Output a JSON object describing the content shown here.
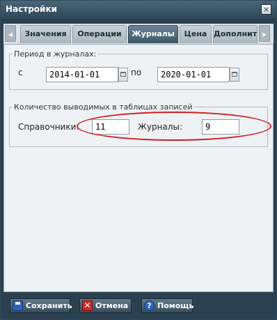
{
  "window": {
    "title": "Настройки",
    "close_glyph": "×"
  },
  "tabs": [
    {
      "label": "Значения"
    },
    {
      "label": "Операции"
    },
    {
      "label": "Журналы"
    },
    {
      "label": "Цена"
    },
    {
      "label": "Дополнит"
    }
  ],
  "tab_scroll": {
    "left_glyph": "◂",
    "right_glyph": "▸"
  },
  "period": {
    "legend": "Период в журналах:",
    "from_label": "с",
    "from_value": "2014-01-01",
    "to_label": "по",
    "to_value": "2020-01-01"
  },
  "records": {
    "legend": "Количество выводимых в таблицах записей",
    "reference_label": "Справочники:",
    "reference_value": "11",
    "journals_label": "Журналы:",
    "journals_value": "9"
  },
  "buttons": {
    "save": "Сохранить",
    "cancel": "Отмена",
    "help": "Помощь",
    "cancel_glyph": "✕",
    "help_glyph": "?"
  },
  "colors": {
    "annotation": "#cc1f1f",
    "active_tab": "#3d5666"
  }
}
